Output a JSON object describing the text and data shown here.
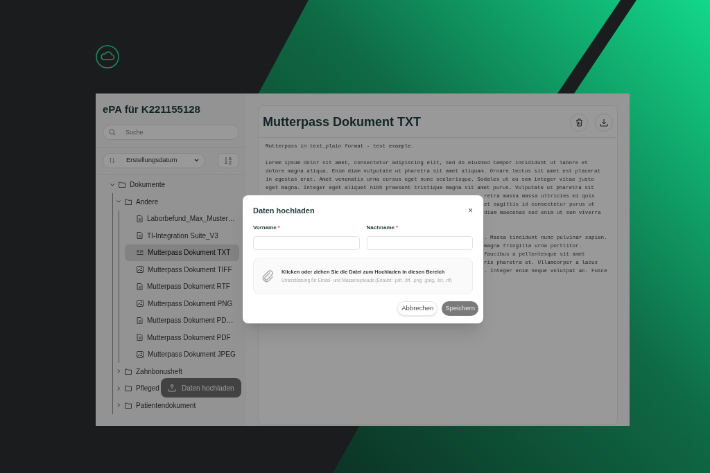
{
  "app": {
    "title": "ePA für K221155128",
    "search": {
      "placeholder": "Suche"
    },
    "sort": {
      "value": "Erstellungsdatum"
    },
    "tree": [
      {
        "label": "Dokumente",
        "kind": "folder",
        "expanded": true,
        "selected": false,
        "children": [
          {
            "label": "Andere",
            "kind": "folder",
            "expanded": true,
            "selected": false,
            "children": [
              {
                "label": "Laborbefund_Max_Muster…",
                "kind": "doc",
                "selected": false
              },
              {
                "label": "TI-Integration Suite_V3",
                "kind": "doc",
                "selected": false
              },
              {
                "label": "Mutterpass Dokument TXT",
                "kind": "text",
                "selected": true
              },
              {
                "label": "Mutterpass Dokument TIFF",
                "kind": "image",
                "selected": false
              },
              {
                "label": "Mutterpass Dokument RTF",
                "kind": "doc",
                "selected": false
              },
              {
                "label": "Mutterpass Dokument PNG",
                "kind": "image",
                "selected": false
              },
              {
                "label": "Mutterpass Dokument PD…",
                "kind": "doc",
                "selected": false
              },
              {
                "label": "Mutterpass Dokument PDF",
                "kind": "doc",
                "selected": false
              },
              {
                "label": "Mutterpass Dokument JPEG",
                "kind": "image",
                "selected": false
              }
            ]
          },
          {
            "label": "Zahnbonusheft",
            "kind": "folder",
            "expanded": false,
            "selected": false
          },
          {
            "label": "Pfleged",
            "kind": "folder",
            "expanded": false,
            "selected": false
          },
          {
            "label": "Patientendokument",
            "kind": "folder",
            "expanded": false,
            "selected": false
          }
        ]
      }
    ],
    "upload_button": "Daten hochladen"
  },
  "document": {
    "title": "Mutterpass Dokument TXT",
    "lines": [
      {
        "kind": "full",
        "text": "Mutterpass in text_plain format - test example."
      },
      {
        "kind": "blank"
      },
      {
        "kind": "full",
        "text": "Lorem ipsum dolor sit amet, consectetur adipiscing elit, sed do eiusmod tempor incididunt ut labore et"
      },
      {
        "kind": "full",
        "text": "dolore magna aliqua. Enim diam vulputate ut pharetra sit amet aliquam. Ornare lectus sit amet est placerat"
      },
      {
        "kind": "full",
        "text": "in egestas erat. Amet venenatis urna cursus eget nunc scelerisque. Sodales ut eu sem integer vitae justo"
      },
      {
        "kind": "full",
        "text": "eget magna. Integer eget aliquet nibh praesent tristique magna sit amet purus. Vulputate ut pharetra sit"
      },
      {
        "kind": "partial",
        "text": "retra massa massa ultricies mi quis"
      },
      {
        "kind": "partial",
        "text": "et sagittis id consectetur purus ut"
      },
      {
        "kind": "partial",
        "text": "diam maecenas sed enim ut sem viverra"
      },
      {
        "kind": "blank"
      },
      {
        "kind": "blank"
      },
      {
        "kind": "partial",
        "text": ". Massa tincidunt nunc pulvinar sapien."
      },
      {
        "kind": "partial",
        "text": "magna fringilla urna porttitor."
      },
      {
        "kind": "partial",
        "text": "faucibus a pellentesque sit amet"
      },
      {
        "kind": "partial",
        "text": "ris pharetra et. Ullamcorper a lacus"
      },
      {
        "kind": "partial",
        "text": ". Integer enim neque volutpat ac. Fusce"
      }
    ]
  },
  "modal": {
    "title": "Daten hochladen",
    "close": "×",
    "fields": [
      {
        "label": "Vorname",
        "required_mark": "*"
      },
      {
        "label": "Nachname",
        "required_mark": "*"
      }
    ],
    "dropzone": {
      "title": "Klicken oder ziehen Sie die Datei zum Hochladen in diesen Bereich",
      "hint": "Unterstützung für Einzel- und Massenuploads (Erlaubt: .pdf, .tiff, .png, .jpeg, .txt, .rtf)"
    },
    "buttons": [
      {
        "label": "Abbrechen",
        "kind": "secondary",
        "disabled": false
      },
      {
        "label": "Speichern",
        "kind": "primary",
        "disabled": true
      }
    ]
  }
}
